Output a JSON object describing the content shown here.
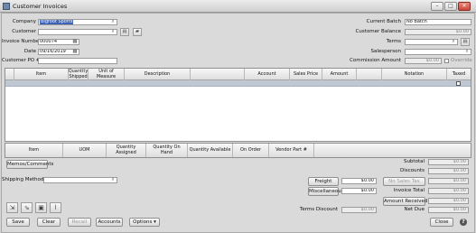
{
  "window": {
    "title": "Customer Invoices"
  },
  "form": {
    "company": {
      "label": "Company",
      "value": "Bigfoot Sports"
    },
    "customer": {
      "label": "Customer",
      "value": ""
    },
    "invoice_number": {
      "label": "Invoice Number",
      "value": "000074"
    },
    "date": {
      "label": "Date",
      "value": "09/16/2019"
    },
    "customer_po": {
      "label": "Customer PO #",
      "value": ""
    },
    "current_batch": {
      "label": "Current Batch",
      "value": "No Batch"
    },
    "customer_balance": {
      "label": "Customer Balance",
      "value": "$0.00"
    },
    "terms": {
      "label": "Terms",
      "value": ""
    },
    "salesperson": {
      "label": "Salesperson",
      "value": ""
    },
    "commission_amount": {
      "label": "Commission Amount",
      "value": "$0.00",
      "override_label": "Override"
    }
  },
  "items_grid": {
    "columns": [
      "Item",
      "Quantity Shipped",
      "Unit of Measure",
      "Description",
      "Account",
      "Sales Price",
      "Amount",
      "Notation",
      "Taxed"
    ]
  },
  "inventory_grid": {
    "columns": [
      "Item",
      "UOM",
      "Quantity Assigned",
      "Quantity On Hand",
      "Quantity Available",
      "On Order",
      "Vendor Part #"
    ]
  },
  "memos_button": "Memos/Comments",
  "shipping_method": {
    "label": "Shipping Method",
    "value": ""
  },
  "totals": {
    "subtotal": {
      "label": "Subtotal",
      "value": "$0.00"
    },
    "discounts": {
      "label": "Discounts",
      "value": "$0.00"
    },
    "freight": {
      "label": "Freight",
      "value": "$0.00"
    },
    "no_sales_tax": {
      "label": "No Sales Tax",
      "value": "$0.00"
    },
    "miscellaneous": {
      "label": "Miscellaneous",
      "value": "$0.00"
    },
    "invoice_total": {
      "label": "Invoice Total",
      "value": "$0.00"
    },
    "amount_received": {
      "label": "Amount Received",
      "value": "$0.00"
    },
    "terms_discount": {
      "label": "Terms Discount",
      "value": "$0.00"
    },
    "net_due": {
      "label": "Net Due",
      "value": "$0.00"
    }
  },
  "footer": {
    "save": "Save",
    "clear": "Clear",
    "recall": "Recall",
    "accounts": "Accounts",
    "options": "Options",
    "close": "Close"
  },
  "icons": {
    "search": "search-icon",
    "calendar": "calendar-icon",
    "help": "help-icon"
  }
}
